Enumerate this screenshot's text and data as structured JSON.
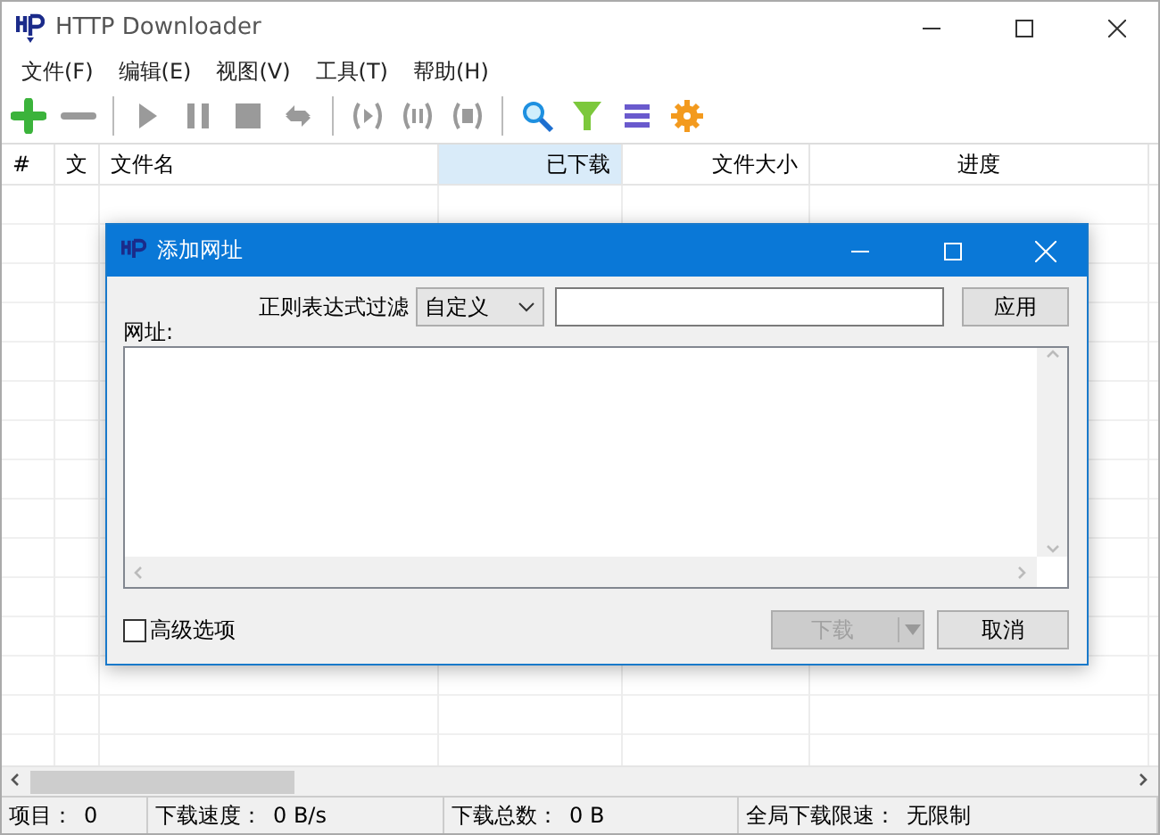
{
  "window": {
    "title": "HTTP Downloader"
  },
  "menu": [
    "文件(F)",
    "编辑(E)",
    "视图(V)",
    "工具(T)",
    "帮助(H)"
  ],
  "table": {
    "columns": [
      {
        "label": "#",
        "selected": false
      },
      {
        "label": "文",
        "selected": false
      },
      {
        "label": "文件名",
        "selected": false
      },
      {
        "label": "已下载",
        "selected": true
      },
      {
        "label": "文件大小",
        "selected": false
      },
      {
        "label": "进度",
        "selected": false
      }
    ]
  },
  "status_bar": [
    {
      "label": "项目：",
      "value": "0"
    },
    {
      "label": "下载速度：",
      "value": "0 B/s"
    },
    {
      "label": "下载总数：",
      "value": "0 B"
    },
    {
      "label": "全局下载限速：",
      "value": "无限制"
    }
  ],
  "dialog": {
    "title": "添加网址",
    "filter_label": "正则表达式过滤",
    "filter_select": "自定义",
    "apply_button": "应用",
    "url_label": "网址:",
    "advanced": {
      "label": "高级选项",
      "checked": false
    },
    "download_button": {
      "label": "下载",
      "disabled": true
    },
    "cancel_button": "取消"
  }
}
